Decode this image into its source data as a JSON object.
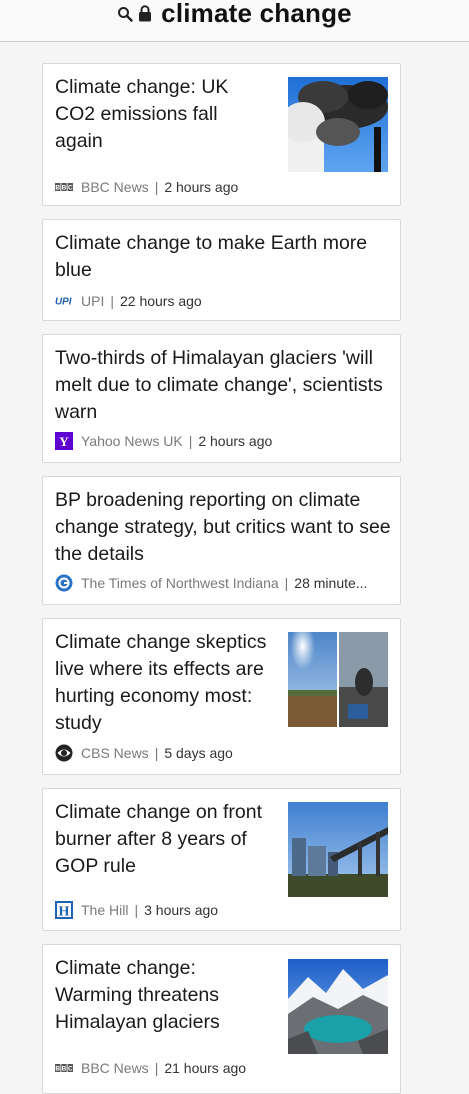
{
  "search": {
    "query": "climate change"
  },
  "articles": [
    {
      "headline": "Climate change: UK CO2 emissions fall again",
      "source": "BBC News",
      "time": "2 hours ago",
      "source_icon": "bbc-logo-icon",
      "thumbnail": "smokestack-emissions-photo"
    },
    {
      "headline": "Climate change to make Earth more blue",
      "source": "UPI",
      "time": "22 hours ago",
      "source_icon": "upi-logo-icon"
    },
    {
      "headline": "Two-thirds of Himalayan glaciers 'will melt due to climate change', scientists warn",
      "source": "Yahoo News UK",
      "time": "2 hours ago",
      "source_icon": "yahoo-logo-icon"
    },
    {
      "headline": "BP broadening reporting on climate change strategy, but critics want to see the details",
      "source": "The Times of Northwest Indiana",
      "time": "28 minute...",
      "source_icon": "nwi-times-logo-icon"
    },
    {
      "headline": "Climate change skeptics live where its effects are hurting economy most: study",
      "source": "CBS News",
      "time": "5 days ago",
      "source_icon": "cbs-eye-logo-icon",
      "thumbnail": "drought-landscape-photo"
    },
    {
      "headline": "Climate change on front burner after 8 years of GOP rule",
      "source": "The Hill",
      "time": "3 hours ago",
      "source_icon": "the-hill-logo-icon",
      "thumbnail": "coal-plant-photo"
    },
    {
      "headline": "Climate change: Warming threatens Himalayan glaciers",
      "source": "BBC News",
      "time": "21 hours ago",
      "source_icon": "bbc-logo-icon",
      "thumbnail": "himalayan-glacier-lake-photo"
    }
  ],
  "brand": {
    "bbc": "BBC",
    "upi": "UPI",
    "yahoo": "Y",
    "hill": "H"
  },
  "colors": {
    "yahoo": "#5f01d1",
    "upi": "#1d5fb0",
    "nwi": "#2a73c9",
    "hill": "#1b63b5",
    "link_gray": "#7a7a7a"
  }
}
